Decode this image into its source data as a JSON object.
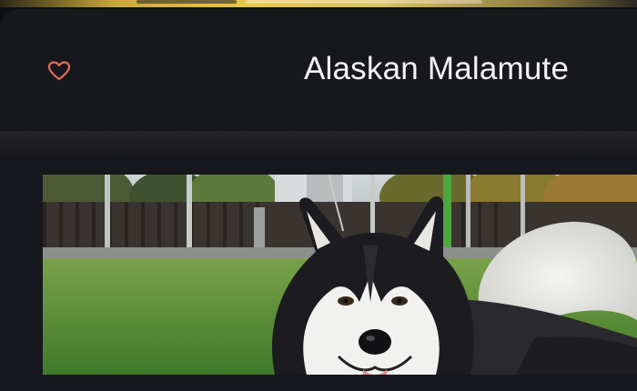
{
  "header": {
    "title": "Alaskan Malamute",
    "favorite_icon": "heart-outline-icon",
    "favorite_color": "#e8695a"
  },
  "photo": {
    "subject": "dog-photo"
  },
  "colors": {
    "background": "#17181d",
    "title_text": "#f2f2f4"
  }
}
